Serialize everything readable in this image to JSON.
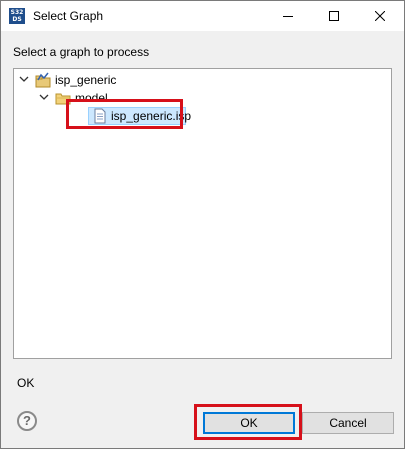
{
  "window": {
    "title": "Select Graph",
    "app_icon_text_top": "S32",
    "app_icon_text_bottom": "DS"
  },
  "dialog": {
    "instruction": "Select a graph to process",
    "status_message": "OK"
  },
  "tree": {
    "project": {
      "label": "isp_generic",
      "expanded": true,
      "icon": "project-icon"
    },
    "folder": {
      "label": "model",
      "expanded": true,
      "icon": "folder-icon"
    },
    "file": {
      "label": "isp_generic.isp",
      "selected": true,
      "icon": "file-icon"
    }
  },
  "buttons": {
    "ok_label": "OK",
    "cancel_label": "Cancel",
    "help_glyph": "?"
  },
  "colors": {
    "highlight_red": "#d6101a",
    "selection": "#cce8ff",
    "default_button_border": "#0078d7"
  }
}
